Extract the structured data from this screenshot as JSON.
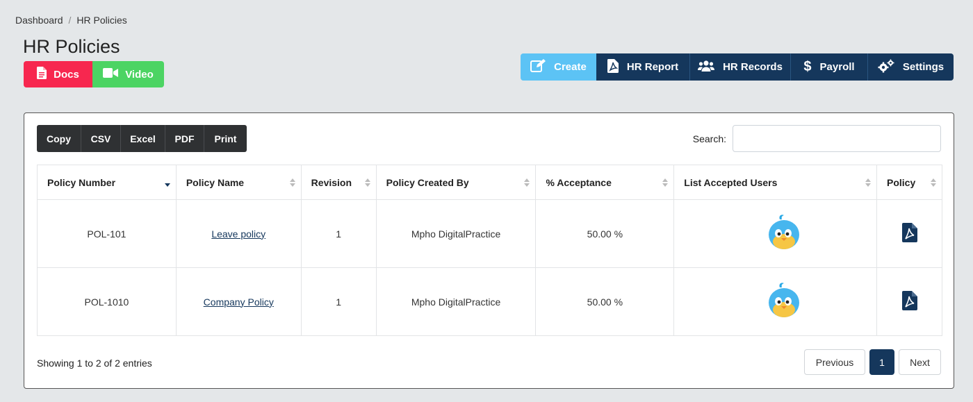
{
  "breadcrumb": {
    "home": "Dashboard",
    "separator": "/",
    "current": "HR Policies"
  },
  "page": {
    "title": "HR Policies"
  },
  "help": {
    "docs_label": "Docs",
    "video_label": "Video"
  },
  "actions": {
    "create": "Create",
    "report": "HR Report",
    "records": "HR Records",
    "payroll": "Payroll",
    "settings": "Settings"
  },
  "export": {
    "copy": "Copy",
    "csv": "CSV",
    "excel": "Excel",
    "pdf": "PDF",
    "print": "Print"
  },
  "search": {
    "label": "Search:",
    "value": "",
    "placeholder": ""
  },
  "table": {
    "headers": {
      "number": "Policy Number",
      "name": "Policy Name",
      "revision": "Revision",
      "created_by": "Policy Created By",
      "acceptance": "% Acceptance",
      "accepted_users": "List Accepted Users",
      "policy": "Policy"
    },
    "sorted_column": "number",
    "sort_direction": "desc",
    "rows": [
      {
        "number": "POL-101",
        "name": "Leave policy",
        "revision": "1",
        "created_by": "Mpho DigitalPractice",
        "acceptance": "50.00 %",
        "user_avatar": "blue-bird-avatar",
        "policy_icon": "pdf-file-icon"
      },
      {
        "number": "POL-1010",
        "name": "Company Policy",
        "revision": "1",
        "created_by": "Mpho DigitalPractice",
        "acceptance": "50.00 %",
        "user_avatar": "blue-bird-avatar",
        "policy_icon": "pdf-file-icon"
      }
    ]
  },
  "footer": {
    "info": "Showing 1 to 2 of 2 entries",
    "previous": "Previous",
    "current_page": "1",
    "next": "Next"
  },
  "colors": {
    "background": "#e4e7e9",
    "navy": "#15375c",
    "create": "#5cc3f5",
    "docs": "#f7274f",
    "video": "#4cd463",
    "export": "#2f3133"
  }
}
